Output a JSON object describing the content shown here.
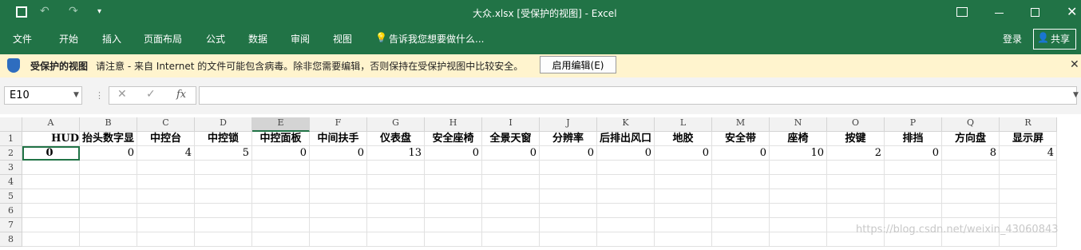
{
  "window": {
    "title": "大众.xlsx  [受保护的视图] - Excel",
    "login": "登录",
    "share": "共享"
  },
  "menu": [
    "文件",
    "开始",
    "插入",
    "页面布局",
    "公式",
    "数据",
    "审阅",
    "视图"
  ],
  "tell_me": "告诉我您想要做什么...",
  "protected": {
    "title": "受保护的视图",
    "message": "请注意 - 来自 Internet 的文件可能包含病毒。除非您需要编辑，否则保持在受保护视图中比较安全。",
    "enable_button": "启用编辑(E)"
  },
  "formula_bar": {
    "name_box": "E10",
    "fx_label": "fx"
  },
  "sheet": {
    "columns": [
      "A",
      "B",
      "C",
      "D",
      "E",
      "F",
      "G",
      "H",
      "I",
      "J",
      "K",
      "L",
      "M",
      "N",
      "O",
      "P",
      "Q",
      "R"
    ],
    "rows": [
      "1",
      "2",
      "3",
      "4",
      "5",
      "6",
      "7",
      "8"
    ],
    "row1": [
      "HUD",
      "抬头数字显",
      "中控台",
      "中控锁",
      "中控面板",
      "中间扶手",
      "仪表盘",
      "安全座椅",
      "全景天窗",
      "分辨率",
      "后排出风口",
      "地胶",
      "安全带",
      "座椅",
      "按键",
      "排挡",
      "方向盘",
      "显示屏"
    ],
    "row2": [
      "0",
      "0",
      "4",
      "5",
      "0",
      "0",
      "13",
      "0",
      "0",
      "0",
      "0",
      "0",
      "0",
      "10",
      "2",
      "0",
      "8",
      "4"
    ]
  },
  "watermark": "https://blog.csdn.net/weixin_43060843",
  "colors": {
    "accent": "#217346",
    "warning_bg": "#fff4ce"
  }
}
